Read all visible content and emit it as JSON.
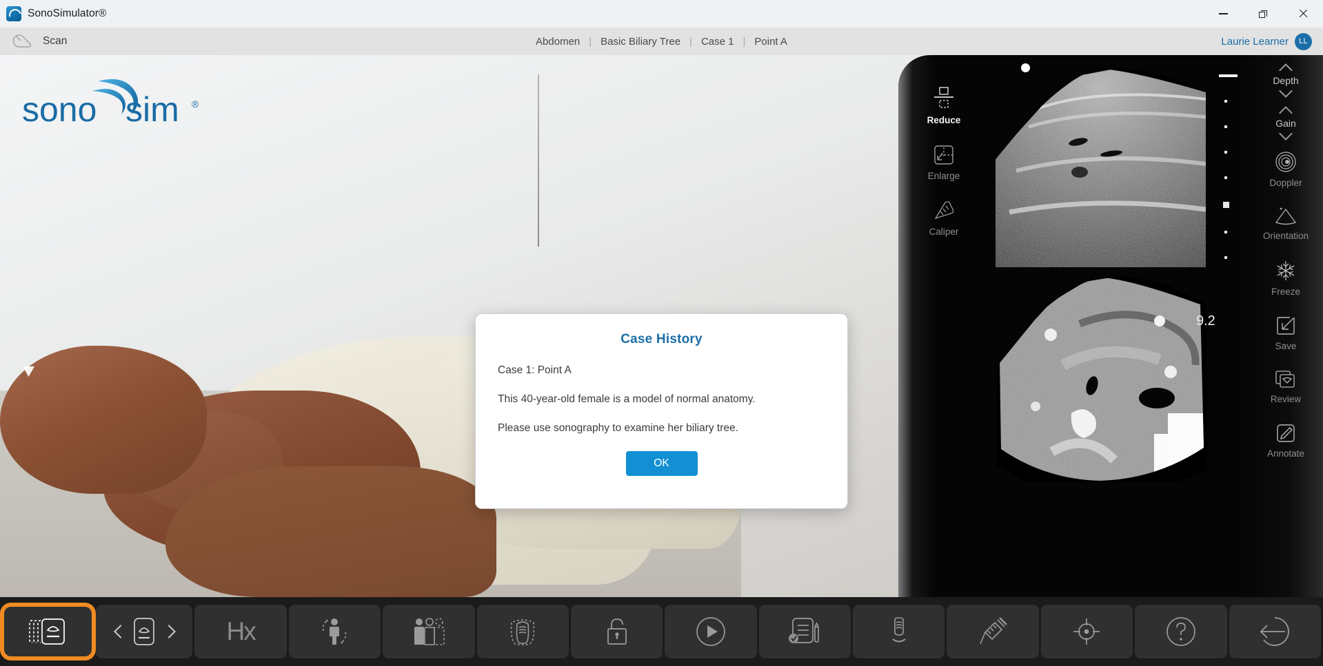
{
  "window": {
    "title": "SonoSimulator®",
    "app_icon": "sonosim-app-icon",
    "minimize": "—",
    "restore": "restore-icon",
    "close": "✕"
  },
  "menubar": {
    "scan_label": "Scan",
    "scan_icon": "transducer-icon",
    "breadcrumb": [
      "Abdomen",
      "Basic Biliary Tree",
      "Case 1",
      "Point A"
    ],
    "separator": "|",
    "user_name": "Laurie Learner",
    "user_initials": "LL"
  },
  "stage": {
    "logo_text_1": "sono",
    "logo_text_2": "sim",
    "logo_registered": "®"
  },
  "pager": {
    "prev_label": "previous-case",
    "next_label": "next-case",
    "dots": [
      true,
      false,
      false
    ]
  },
  "dialog": {
    "title": "Case History",
    "lines": [
      "Case 1: Point A",
      "This 40-year-old female is a model of normal anatomy.",
      "Please use sonography to examine her biliary tree."
    ],
    "ok_label": "OK"
  },
  "machine": {
    "left_controls": [
      {
        "label": "Reduce",
        "icon": "reduce-icon",
        "active": true
      },
      {
        "label": "Enlarge",
        "icon": "enlarge-icon",
        "active": false
      },
      {
        "label": "Caliper",
        "icon": "caliper-icon",
        "active": false
      }
    ],
    "steppers": [
      {
        "label": "Depth",
        "up": "chevron-up-icon",
        "down": "chevron-down-icon"
      },
      {
        "label": "Gain",
        "up": "chevron-up-icon",
        "down": "chevron-down-icon"
      }
    ],
    "right_controls": [
      {
        "label": "Doppler",
        "icon": "doppler-icon"
      },
      {
        "label": "Orientation",
        "icon": "orientation-icon"
      },
      {
        "label": "Freeze",
        "icon": "freeze-snowflake-icon"
      },
      {
        "label": "Save",
        "icon": "save-icon"
      },
      {
        "label": "Review",
        "icon": "review-icon"
      },
      {
        "label": "Annotate",
        "icon": "annotate-pencil-icon"
      }
    ],
    "depth_value": "9.2"
  },
  "toolbar": {
    "buttons": [
      {
        "name": "scan-library-button",
        "icon": "stacked-probe-icon",
        "active": true
      },
      {
        "name": "scan-navigator-button",
        "icon": "probe-prev-next-icon",
        "active": false
      },
      {
        "name": "history-button",
        "icon": "hx-icon",
        "label": "Hx",
        "active": false
      },
      {
        "name": "rotate-patient-button",
        "icon": "rotate-patient-icon",
        "active": false
      },
      {
        "name": "select-patient-button",
        "icon": "multiple-patients-icon",
        "active": false
      },
      {
        "name": "probe-position-button",
        "icon": "probe-footprint-icon",
        "active": false
      },
      {
        "name": "lock-button",
        "icon": "lock-icon",
        "active": false
      },
      {
        "name": "play-button",
        "icon": "play-circle-icon",
        "active": false
      },
      {
        "name": "quiz-button",
        "icon": "checklist-pen-icon",
        "active": false
      },
      {
        "name": "transducer-button",
        "icon": "transducer-upright-icon",
        "active": false
      },
      {
        "name": "needle-button",
        "icon": "syringe-icon",
        "active": false
      },
      {
        "name": "target-button",
        "icon": "crosshair-icon",
        "active": false
      },
      {
        "name": "help-button",
        "icon": "question-circle-icon",
        "active": false
      },
      {
        "name": "exit-button",
        "icon": "back-arrow-circle-icon",
        "active": false
      }
    ]
  },
  "colors": {
    "accent_blue": "#1390d4",
    "brand_blue": "#1b6ea8",
    "active_orange": "#ef8b22",
    "titlebar_bg": "#eef2f5",
    "menubar_bg": "#e2e2e2",
    "toolbar_bg": "#1b1b1b"
  }
}
